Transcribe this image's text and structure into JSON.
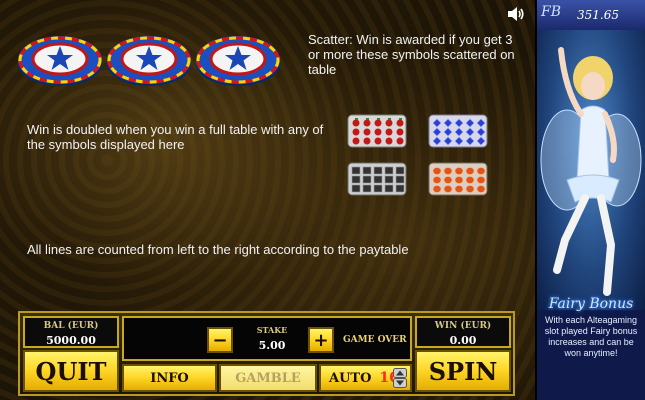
{
  "info": {
    "scatter_text": "Scatter: Win is awarded if you get 3 or more these symbols scattered on table",
    "double_text": "Win is doubled when you win a full table with any of the symbols displayed here",
    "lines_text": "All lines are counted from left to the right according to the paytable"
  },
  "icons": {
    "sound": "speaker-icon",
    "scatter_chip": "star-chip-icon"
  },
  "controls": {
    "balance_label": "BAL (EUR)",
    "balance_value": "5000.00",
    "stake_label": "STAKE",
    "stake_value": "5.00",
    "game_status": "GAME OVER",
    "win_label": "WIN (EUR)",
    "win_value": "0.00",
    "quit_label": "QUIT",
    "info_label": "INFO",
    "gamble_label": "GAMBLE",
    "auto_label": "AUTO",
    "auto_value": "16",
    "spin_label": "SPIN",
    "minus_label": "−",
    "plus_label": "+"
  },
  "sidebar": {
    "credit": "351.65",
    "logo": "FB",
    "title": "Fairy Bonus",
    "promo_text": "With each Alteagaming slot played Fairy bonus increases and can be won anytime!"
  },
  "colors": {
    "gold": "#ffd82a",
    "gold_border": "#c9a722",
    "auto_number": "#ff2a1a",
    "gamble_disabled": "#b8a060"
  }
}
